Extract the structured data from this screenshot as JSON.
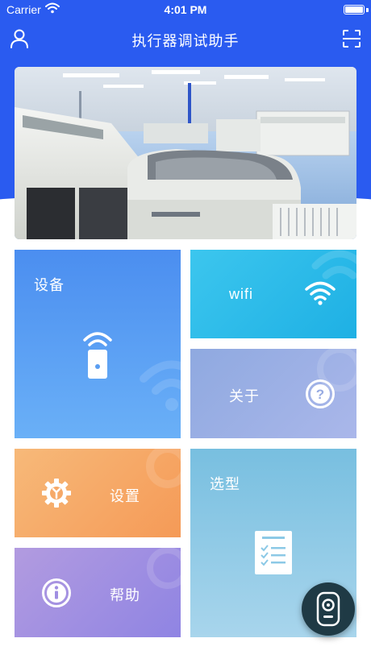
{
  "status_bar": {
    "carrier": "Carrier",
    "time": "4:01 PM",
    "wifi_icon": "wifi-icon",
    "battery_icon": "battery-icon"
  },
  "nav": {
    "title": "执行器调试助手",
    "left_icon": "user-icon",
    "right_icon": "scan-icon"
  },
  "banner": {
    "image": "factory-production-line-photo"
  },
  "tiles": {
    "device": {
      "label": "设备",
      "icon": "remote-control-icon",
      "color": "#4b8ef0"
    },
    "wifi": {
      "label": "wifi",
      "icon": "wifi-icon",
      "color": "#28b8e8"
    },
    "about": {
      "label": "关于",
      "icon": "question-circle-icon",
      "color": "#9aafe4"
    },
    "settings": {
      "label": "设置",
      "icon": "gear-wrench-icon",
      "color": "#f6a968"
    },
    "help": {
      "label": "帮助",
      "icon": "info-circle-icon",
      "color": "#a08fe2"
    },
    "selection": {
      "label": "选型",
      "icon": "checklist-document-icon",
      "color": "#8cc9e6"
    }
  },
  "fab": {
    "icon": "remote-control-icon",
    "color": "#1f3a45"
  },
  "colors": {
    "header_blue": "#2a5bf0",
    "background": "#ffffff"
  }
}
